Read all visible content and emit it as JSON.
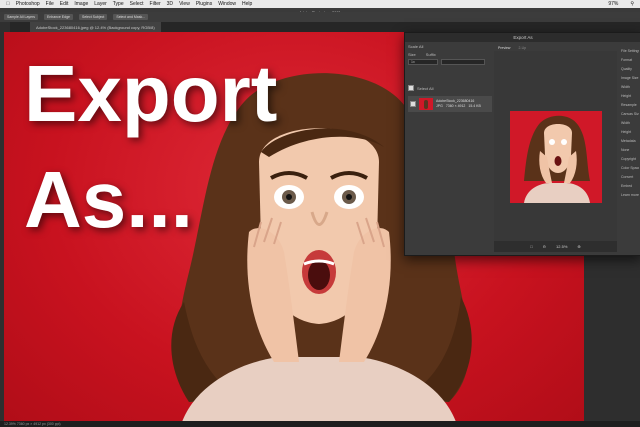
{
  "menubar": {
    "items": [
      "Photoshop",
      "File",
      "Edit",
      "Image",
      "Layer",
      "Type",
      "Select",
      "Filter",
      "3D",
      "View",
      "Plugins",
      "Window",
      "Help"
    ],
    "battery": "97%"
  },
  "app_title": "Adobe Photoshop 2021",
  "options_bar": {
    "buttons": [
      "Sample All Layers",
      "Enhance Edge",
      "Select Subject",
      "Select and Mask..."
    ]
  },
  "document_tab": "AdobeStock_223680416.jpeg @ 12.4% (Background copy, RGB/8)",
  "canvas": {
    "line1": "Export",
    "line2": "As...",
    "colors": {
      "background": "#d01828",
      "text": "#ffffff"
    }
  },
  "export_dialog": {
    "title": "Export As",
    "scale_all": "Scale All",
    "size_label": "Size",
    "suffix_label": "Suffix",
    "size_value": "1x",
    "suffix_value": "",
    "select_all": "Select All",
    "asset": {
      "name": "AdobeStock_223680416",
      "format": "JPG",
      "dimensions": "7360 × 4912",
      "filesize": "15.4 KB"
    },
    "preview_tabs": [
      "Preview",
      "2-Up"
    ],
    "zoom": "12.5%",
    "right_panel": [
      "File Settings",
      "Format",
      "Quality",
      "Image Size",
      "Width",
      "Height",
      "Resample",
      "Canvas Size",
      "Width",
      "Height",
      "Metadata",
      "None",
      "Copyright",
      "Color Space",
      "Convert",
      "Embed",
      "Learn more"
    ]
  },
  "status": "12.39%  7360 px × 4912 px (300 ppi)"
}
